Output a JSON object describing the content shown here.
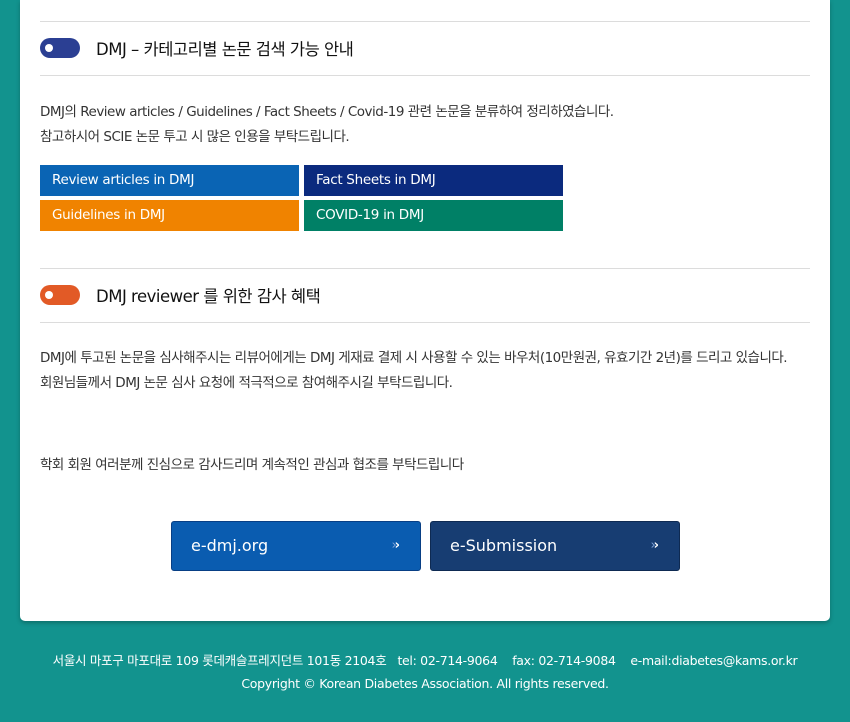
{
  "section1": {
    "title": "DMJ – 카테고리별 논문 검색 가능 안내",
    "line1": "DMJ의 Review articles / Guidelines / Fact Sheets / Covid-19 관련 논문을 분류하여 정리하였습니다.",
    "line2": "참고하시어 SCIE 논문 투고 시 많은 인용을 부탁드립니다.",
    "buttons": [
      {
        "label": "Review articles in DMJ",
        "color": "#0a64b4"
      },
      {
        "label": "Fact Sheets in DMJ",
        "color": "#0b2a7e"
      },
      {
        "label": "Guidelines in DMJ",
        "color": "#f08300"
      },
      {
        "label": "COVID-19 in DMJ",
        "color": "#008066"
      }
    ]
  },
  "section2": {
    "title": "DMJ reviewer 를 위한 감사 혜택",
    "line1": "DMJ에 투고된 논문을 심사해주시는 리뷰어에게는 DMJ 게재료 결제 시 사용할 수 있는 바우처(10만원권, 유효기간 2년)를 드리고 있습니다.",
    "line2": "회원님들께서 DMJ 논문 심사 요청에 적극적으로 참여해주시길 부탁드립니다.",
    "thanks": "학회 회원 여러분께 진심으로 감사드리며 계속적인 관심과 협조를 부탁드립니다"
  },
  "actions": {
    "edmj": "e-dmj.org",
    "submission": "e-Submission"
  },
  "footer": {
    "address": "서울시 마포구 마포대로 109 롯데캐슬프레지던트 101동 2104호",
    "tel": "tel: 02-714-9064",
    "fax": "fax: 02-714-9084",
    "email": "e-mail:diabetes@kams.or.kr",
    "copyright": "Copyright © Korean Diabetes Association. All rights reserved."
  },
  "colors": {
    "background": "#12938e",
    "toggle_blue": "#2b3f93",
    "toggle_orange": "#e25a26",
    "edmj_button": "#0a5cb0",
    "submission_button": "#173d72"
  }
}
